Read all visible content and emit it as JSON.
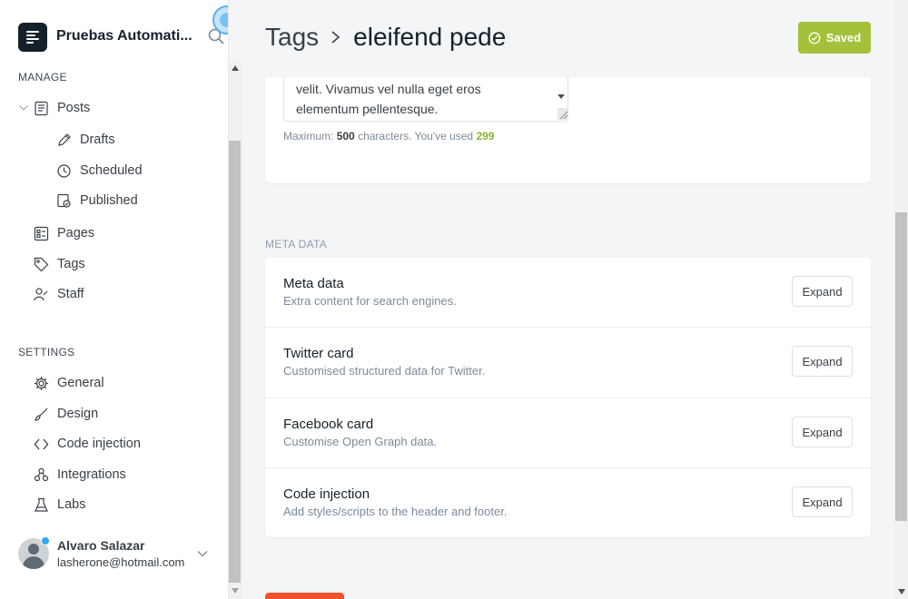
{
  "sidebar": {
    "site_title": "Pruebas Automati...",
    "manage_label": "MANAGE",
    "settings_label": "SETTINGS",
    "manage_items": [
      {
        "label": "Posts",
        "icon": "posts-icon"
      },
      {
        "label": "Drafts",
        "icon": "pencil-icon"
      },
      {
        "label": "Scheduled",
        "icon": "clock-icon"
      },
      {
        "label": "Published",
        "icon": "published-icon"
      },
      {
        "label": "Pages",
        "icon": "pages-icon"
      },
      {
        "label": "Tags",
        "icon": "tag-icon"
      },
      {
        "label": "Staff",
        "icon": "staff-icon"
      }
    ],
    "settings_items": [
      {
        "label": "General",
        "icon": "gear-icon"
      },
      {
        "label": "Design",
        "icon": "brush-icon"
      },
      {
        "label": "Code injection",
        "icon": "code-icon"
      },
      {
        "label": "Integrations",
        "icon": "integrations-icon"
      },
      {
        "label": "Labs",
        "icon": "flask-icon"
      }
    ],
    "user": {
      "name": "Alvaro Salazar",
      "email": "lasherone@hotmail.com"
    }
  },
  "header": {
    "breadcrumb_parent": "Tags",
    "breadcrumb_current": "eleifend pede",
    "saved_label": "Saved"
  },
  "description": {
    "text_line1": "velit. Vivamus vel nulla eget eros",
    "text_line2": "elementum pellentesque.",
    "counter_prefix": "Maximum:",
    "max_chars": "500",
    "counter_mid": "characters. You've used",
    "used_chars": "299"
  },
  "meta": {
    "section_label": "META DATA",
    "expand_label": "Expand",
    "rows": [
      {
        "title": "Meta data",
        "desc": "Extra content for search engines."
      },
      {
        "title": "Twitter card",
        "desc": "Customised structured data for Twitter."
      },
      {
        "title": "Facebook card",
        "desc": "Customise Open Graph data."
      },
      {
        "title": "Code injection",
        "desc": "Add styles/scripts to the header and footer."
      }
    ]
  },
  "colors": {
    "accent_green": "#a3c13a",
    "delete_red": "#f05230",
    "dark": "#15212a"
  }
}
